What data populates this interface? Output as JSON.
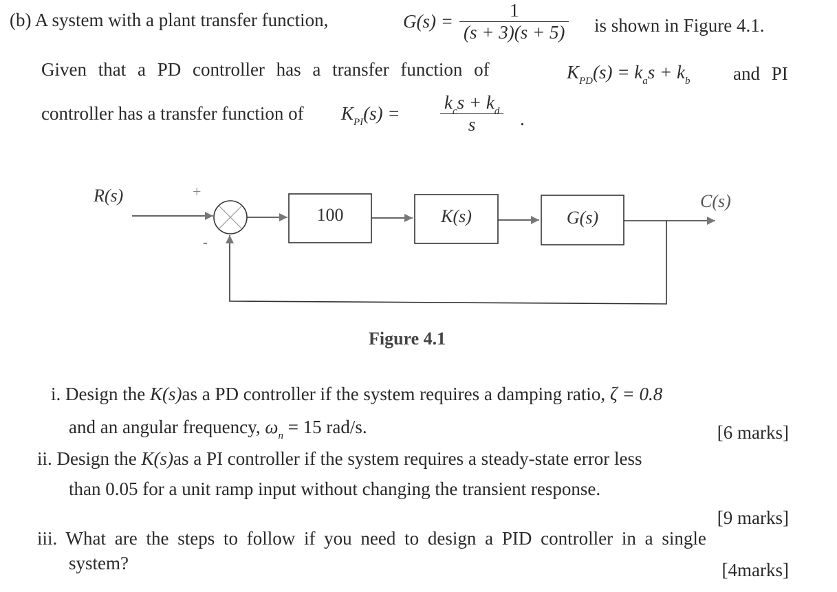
{
  "question": {
    "part_label": "(b)",
    "intro_text": "A system with a plant transfer function,",
    "plant": {
      "lhs": "G(s) =",
      "numerator": "1",
      "denominator": "(s + 3)(s + 5)"
    },
    "intro_tail": "is shown in Figure 4.1.",
    "given_text": "Given that a PD controller has a transfer function of",
    "pd": {
      "K": "K",
      "sub": "PD",
      "arg": "(s) = ",
      "k1": "k",
      "k1_sub": "a",
      "mid": "s + ",
      "k2": "k",
      "k2_sub": "b"
    },
    "and_pi": "and PI",
    "controller_text": "controller has a transfer function of",
    "pi": {
      "K": "K",
      "sub": "PI",
      "arg": "(s) =",
      "num_k1": "k",
      "num_k1_sub": "c",
      "num_mid": "s + ",
      "num_k2": "k",
      "num_k2_sub": "d",
      "denominator": "s"
    },
    "period": "."
  },
  "diagram": {
    "input_label": "R(s)",
    "output_label": "C(s)",
    "plus_sign": "+",
    "minus_sign": "-",
    "blocks": [
      "100",
      "K(s)",
      "G(s)"
    ],
    "caption": "Figure 4.1"
  },
  "subquestions": [
    {
      "number": "i.",
      "line1_a": "Design the",
      "line1_k": "K(s)",
      "line1_b": "as a PD controller if the system requires a damping ratio,",
      "line1_zeta": "ζ = 0.8",
      "line2": "and an angular frequency,",
      "line2_omega": "ω",
      "line2_omega_sub": "n",
      "line2_value": "= 15 rad/s.",
      "marks": "[6 marks]"
    },
    {
      "number": "ii.",
      "line1_a": "Design the",
      "line1_k": "K(s)",
      "line1_b": "as a PI controller if the system requires a steady-state error less",
      "line2": "than 0.05 for a unit ramp input without changing the transient response.",
      "marks": "[9 marks]"
    },
    {
      "number": "iii.",
      "line1": "What are the steps to follow if you need to design a PID controller in a single",
      "line2": "system?",
      "marks": "[4marks]"
    }
  ]
}
